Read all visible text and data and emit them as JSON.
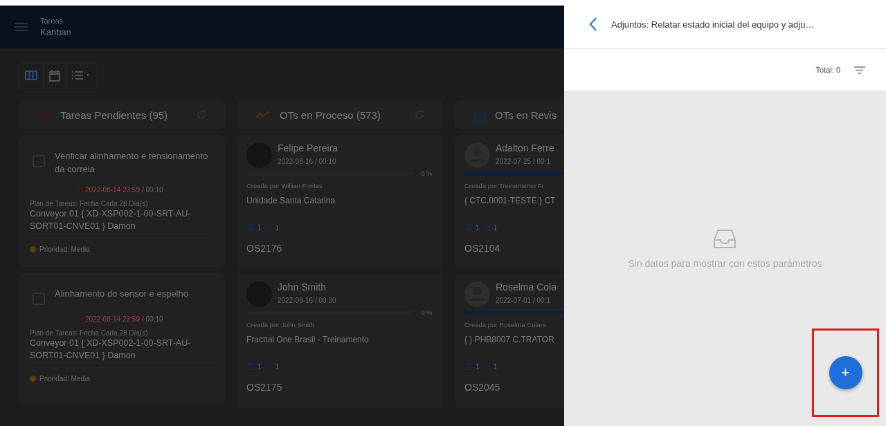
{
  "app_bar": {
    "title": "Tareas",
    "subtitle": "Kanban"
  },
  "view_toggles": [
    {
      "kind": "board",
      "selected": true
    },
    {
      "kind": "calendar",
      "selected": false
    },
    {
      "kind": "list",
      "selected": false
    }
  ],
  "columns": [
    {
      "kind": "tasks",
      "title": "Tareas Pendientes (95)",
      "cards": [
        {
          "checked": false,
          "title": "Verificar alinhamento e tensionamento da correia",
          "due": "2022-08-14 23:59",
          "duration": "/ 00:10",
          "plan": "Plan de Tareas: Fecha Cada 28 Día(s)",
          "asset": "Conveyor 01 { XD-XSP002-1-00-SRT-AU-SORT01-CNVE01 } Damon",
          "priority": "Prioridad: Media",
          "color": "#5a4300"
        },
        {
          "checked": false,
          "title": "Alinhamento do sensor e espelho",
          "due": "2022-08-14 23:59",
          "duration": "/ 00:10",
          "plan": "Plan de Tareas: Fecha Cada 28 Día(s)",
          "asset": "Conveyor 01 { XD-XSP002-1-00-SRT-AU-SORT01-CNVE01 } Damon",
          "priority": "Prioridad: Media",
          "color": "#5a4300"
        }
      ]
    },
    {
      "kind": "orders",
      "title": "OTs en Proceso (573)",
      "cards": [
        {
          "kind": "photo_avatar",
          "name": "Felipe Pereira",
          "date": "2022-08-16 / 00:10",
          "level": 0,
          "percent": "0 %",
          "created_by": "Creada por Willian Freitas",
          "location": "Unidade Santa Catarina",
          "resources": "1",
          "tasks": "1",
          "code": "OS2176"
        },
        {
          "kind": "photo_avatar",
          "name": "John Smith",
          "date": "2022-08-16 / 00:30",
          "level": 0,
          "percent": "0 %",
          "created_by": "Creada por John Smith",
          "location": "Fracttal One Brasil - Treinamento",
          "resources": "1",
          "tasks": "1",
          "code": "OS2175"
        }
      ]
    },
    {
      "kind": "orders",
      "title": "OTs en Revis",
      "cards": [
        {
          "kind": "generic_avatar",
          "name": "Adalton Ferre",
          "date": "2022-07-25 / 00:1",
          "level": 1,
          "created_by": "Creada por Treinamento Fr",
          "location": "{ CTC.0001-TESTE } CT",
          "resources": "1",
          "tasks": "1",
          "code": "OS2104"
        },
        {
          "kind": "generic_avatar",
          "name": "Roselma Cola",
          "date": "2022-07-01 / 00:1",
          "level": 1,
          "created_by": "Creada por Roselma Colare",
          "location": "{ } PHB8007 C.TRATOR",
          "resources": "1",
          "tasks": "1",
          "code": "OS2045"
        }
      ]
    }
  ],
  "panel": {
    "title": "Adjuntos: Relatar estado inicial del equipo y adju…",
    "total": "Total: 0",
    "empty_message": "Sin datos para mostrar con estos parámetros",
    "add_button": "+",
    "add_highlighted": true
  }
}
